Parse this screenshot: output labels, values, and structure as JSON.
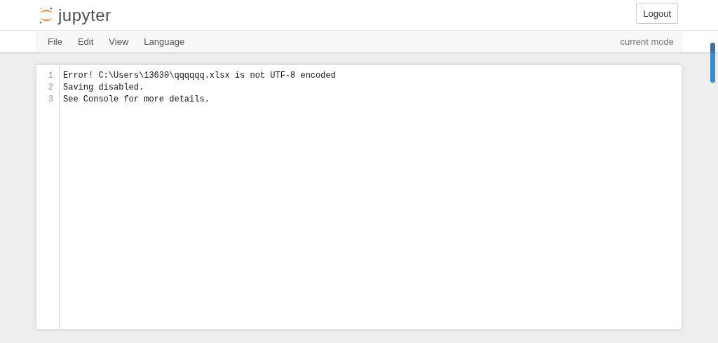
{
  "header": {
    "logo_text": "jupyter",
    "logout_button": "Logout"
  },
  "menubar": {
    "items": [
      "File",
      "Edit",
      "View",
      "Language"
    ],
    "mode": "current mode"
  },
  "editor": {
    "lines": [
      {
        "number": "1",
        "text": "Error! C:\\Users\\13630\\qqqqqq.xlsx is not UTF-8 encoded"
      },
      {
        "number": "2",
        "text": "Saving disabled."
      },
      {
        "number": "3",
        "text": "See Console for more details."
      }
    ]
  }
}
